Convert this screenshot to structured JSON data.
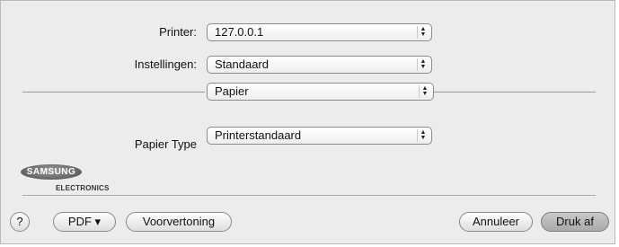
{
  "form": {
    "printer_label": "Printer:",
    "printer_value": "127.0.0.1",
    "presets_label": "Instellingen:",
    "presets_value": "Standaard",
    "panel_value": "Papier",
    "paper_type_label": "Papier Type",
    "paper_type_value": "Printerstandaard"
  },
  "logo": {
    "brand": "SAMSUNG",
    "sub": "ELECTRONICS"
  },
  "buttons": {
    "help": "?",
    "pdf": "PDF ▾",
    "preview": "Voorvertoning",
    "cancel": "Annuleer",
    "print": "Druk af"
  }
}
